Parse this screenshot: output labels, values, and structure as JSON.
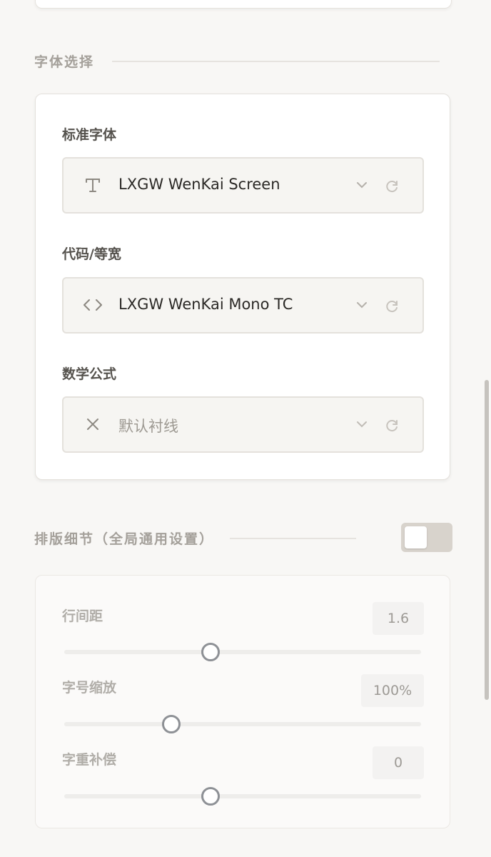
{
  "font_section": {
    "title": "字体选择",
    "fields": [
      {
        "label": "标准字体",
        "value": "LXGW WenKai Screen",
        "icon": "text-t-icon"
      },
      {
        "label": "代码/等宽",
        "value": "LXGW WenKai Mono TC",
        "icon": "code-brackets-icon"
      },
      {
        "label": "数学公式",
        "value": "默认衬线",
        "icon": "close-x-icon"
      }
    ]
  },
  "typography_section": {
    "title": "排版细节（全局通用设置）",
    "toggle_on": false,
    "sliders": [
      {
        "label": "行间距",
        "value": "1.6",
        "level": 0.41
      },
      {
        "label": "字号缩放",
        "value": "100%",
        "level": 0.3
      },
      {
        "label": "字重补偿",
        "value": "0",
        "level": 0.41
      }
    ]
  },
  "colors": {
    "background": "#f8f7f5",
    "card": "#ffffff",
    "toggle_off": "#d8d3cc",
    "slider_thumb": "#8e9196"
  }
}
